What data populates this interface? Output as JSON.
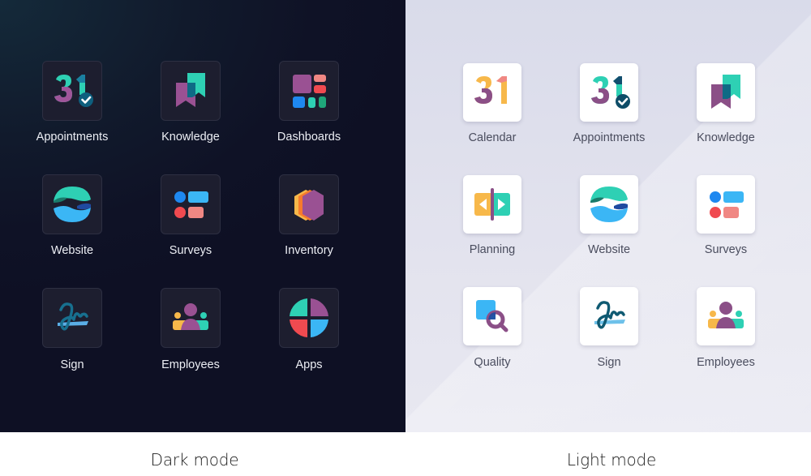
{
  "panels": {
    "dark": {
      "caption": "Dark mode",
      "apps": [
        {
          "label": "Appointments",
          "icon": "appointments-icon"
        },
        {
          "label": "Knowledge",
          "icon": "knowledge-icon"
        },
        {
          "label": "Dashboards",
          "icon": "dashboards-icon"
        },
        {
          "label": "Website",
          "icon": "website-icon"
        },
        {
          "label": "Surveys",
          "icon": "surveys-icon"
        },
        {
          "label": "Inventory",
          "icon": "inventory-icon"
        },
        {
          "label": "Sign",
          "icon": "sign-icon"
        },
        {
          "label": "Employees",
          "icon": "employees-icon"
        },
        {
          "label": "Apps",
          "icon": "apps-icon"
        }
      ]
    },
    "light": {
      "caption": "Light mode",
      "apps": [
        {
          "label": "Calendar",
          "icon": "calendar-icon"
        },
        {
          "label": "Appointments",
          "icon": "appointments-icon"
        },
        {
          "label": "Knowledge",
          "icon": "knowledge-icon"
        },
        {
          "label": "Planning",
          "icon": "planning-icon"
        },
        {
          "label": "Website",
          "icon": "website-icon"
        },
        {
          "label": "Surveys",
          "icon": "surveys-icon"
        },
        {
          "label": "Quality",
          "icon": "quality-icon"
        },
        {
          "label": "Sign",
          "icon": "sign-icon"
        },
        {
          "label": "Employees",
          "icon": "employees-icon"
        }
      ]
    }
  },
  "colors": {
    "teal": "#2ed0b4",
    "purple": "#8b4f87",
    "darkTeal": "#0e6480",
    "yellow": "#f7b84a",
    "coral": "#f08783",
    "red": "#f04a50",
    "blue": "#1e88f0",
    "skyBlue": "#3bb6f5",
    "navy": "#1f4aa0",
    "green": "#1fa77a",
    "orange": "#f77b2c"
  }
}
